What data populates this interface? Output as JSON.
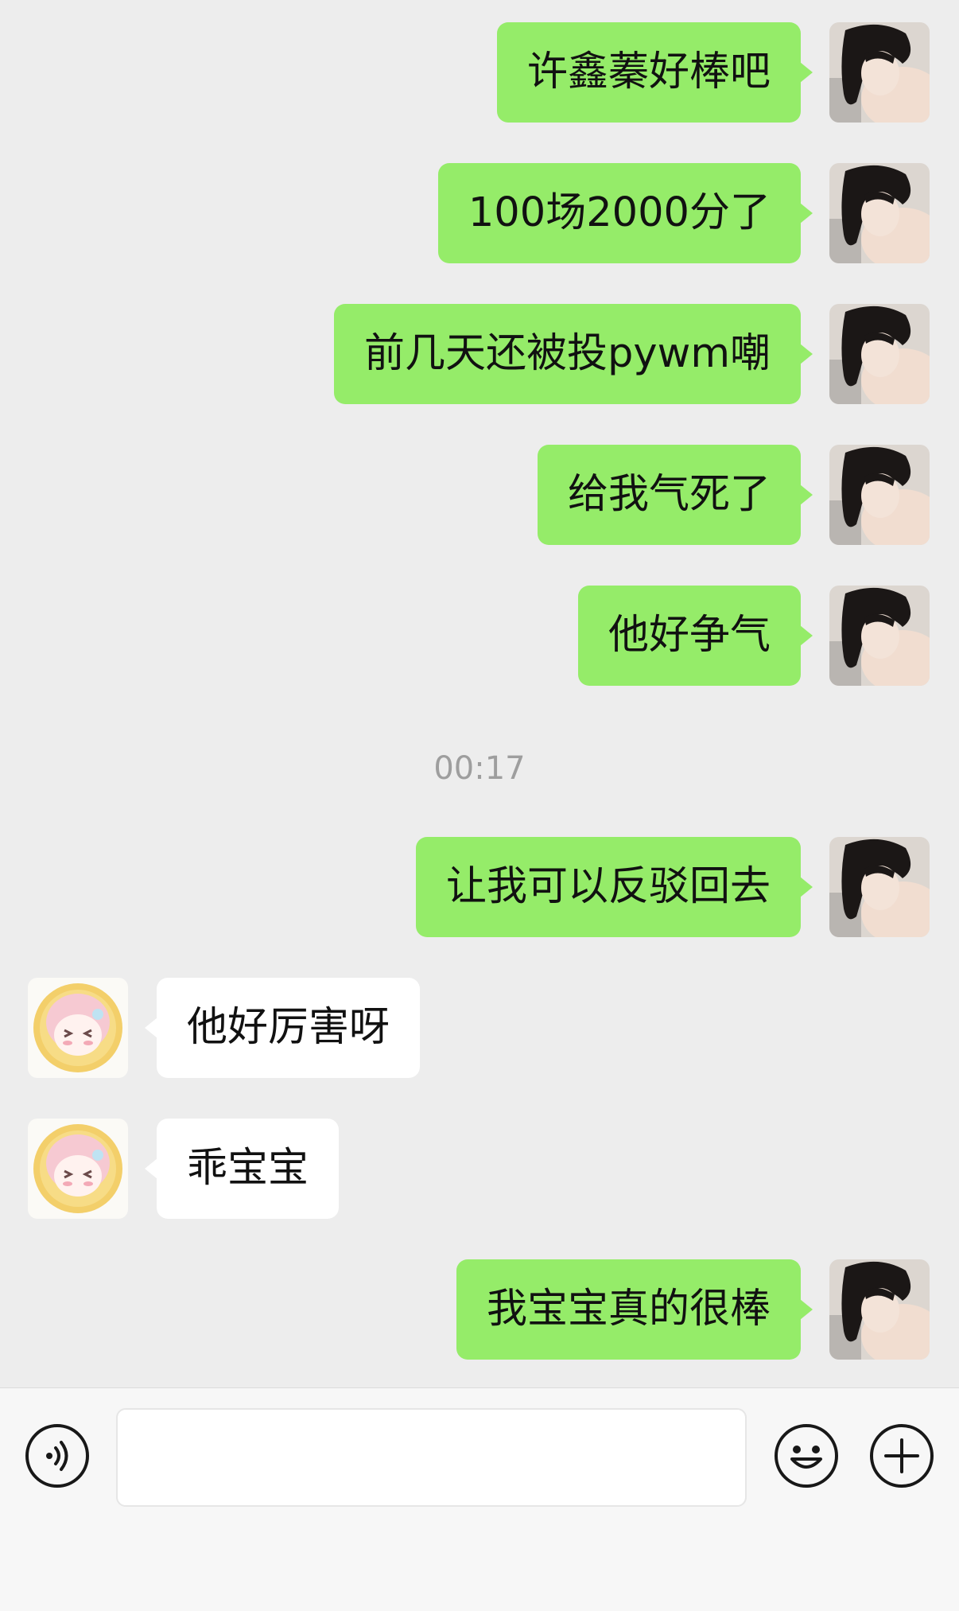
{
  "conversation": {
    "messages_before_time": [
      {
        "sender": "me",
        "text": "许鑫蓁好棒吧"
      },
      {
        "sender": "me",
        "text": "100场2000分了"
      },
      {
        "sender": "me",
        "text": "前几天还被投pywm嘲"
      },
      {
        "sender": "me",
        "text": "给我气死了"
      },
      {
        "sender": "me",
        "text": "他好争气"
      }
    ],
    "timestamp": "00:17",
    "messages_after_time": [
      {
        "sender": "me",
        "text": "让我可以反驳回去"
      },
      {
        "sender": "contact",
        "text": "他好厉害呀"
      },
      {
        "sender": "contact",
        "text": "乖宝宝"
      },
      {
        "sender": "me",
        "text": "我宝宝真的很棒"
      }
    ]
  },
  "composer": {
    "voice_icon": "voice-icon",
    "input_value": "",
    "emoji_icon": "emoji-icon",
    "plus_icon": "plus-icon"
  },
  "colors": {
    "background": "#ededed",
    "my_bubble": "#95ec69",
    "contact_bubble": "#ffffff",
    "timestamp": "#9e9e9e"
  }
}
